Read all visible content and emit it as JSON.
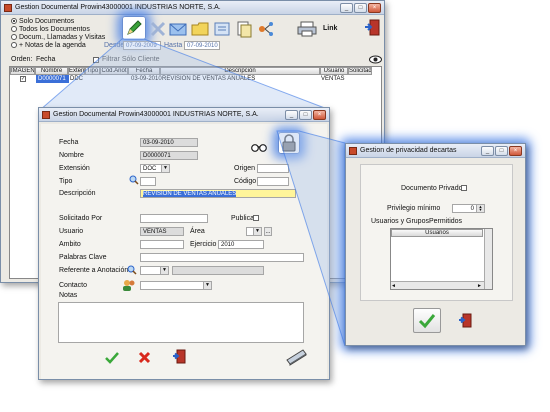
{
  "main": {
    "title": "Gestion Documental Prowin43000001 INDUSTRIAS NORTE, S.A.",
    "filter_options": [
      "Solo Documentos",
      "Todos los Documentos",
      "Docum., Llamadas y Visitas",
      "+ Notas de la agenda"
    ],
    "desde_label": "Desde",
    "desde_value": "07-09-2009",
    "hasta_label": "Hasta",
    "hasta_value": "07-09-2010",
    "link_label": "Link",
    "orden_label": "Orden:",
    "orden_value": "Fecha",
    "filtrar_label": "Filtrar Sólo Cliente",
    "grid_headers": [
      "IMAGEN",
      "Nombre",
      "Extensi",
      "Tipo",
      "Cód.Anot",
      "Fecha",
      "Descripción",
      "Usuario",
      "Solicitad"
    ],
    "grid_row": {
      "nombre": "D0000071",
      "extension": "DDC",
      "fecha": "03-09-2010",
      "descripcion": "REVISIÓN DE VENTAS ANUALES",
      "usuario": "VENTAS"
    }
  },
  "detail": {
    "title": "Gestion Documental Prowin43000001 INDUSTRIAS NORTE, S.A.",
    "labels": {
      "fecha": "Fecha",
      "nombre": "Nombre",
      "extension": "Extensión",
      "tipo": "Tipo",
      "descripcion": "Descripción",
      "origen": "Origen",
      "codigo": "Código",
      "solicitado": "Solicitado Por",
      "publicar": "Publicar",
      "usuario": "Usuario",
      "area": "Área",
      "ambito": "Ambito",
      "ejercicio": "Ejercicio",
      "palabras": "Palabras Clave",
      "referente": "Referente a Anotación",
      "contacto": "Contacto",
      "notas": "Notas"
    },
    "values": {
      "fecha": "03-09-2010",
      "nombre": "D0000071",
      "extension": "DOC",
      "descripcion": "REVISIÓN DE VENTAS ANUALES",
      "usuario": "VENTAS",
      "ejercicio": "2010"
    }
  },
  "privacy": {
    "title": "Gestion de privacidad decartas",
    "doc_privado_label": "Documento Privado",
    "privilegio_label": "Privilegio mínimo",
    "privilegio_value": "0",
    "usuarios_label": "Usuarios y GruposPermitidos",
    "usuarios_header": "Usuarios"
  },
  "colors": {
    "accent": "#3c78e6",
    "highlight": "#fff59a",
    "selection": "#3b6fd8"
  },
  "icons": [
    "pencil-icon",
    "delete-icon",
    "email-icon",
    "folder-icon",
    "search-icon",
    "printer-icon",
    "exit-icon",
    "binoculars-icon",
    "lock-icon",
    "ok-icon",
    "cancel-icon",
    "scanner-icon",
    "contacts-icon"
  ]
}
